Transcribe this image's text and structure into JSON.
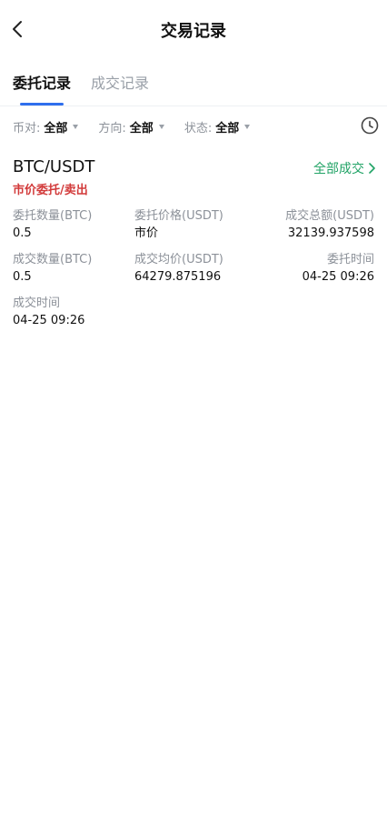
{
  "header": {
    "title": "交易记录"
  },
  "tabs": [
    {
      "label": "委托记录",
      "active": true
    },
    {
      "label": "成交记录",
      "active": false
    }
  ],
  "filters": [
    {
      "label": "币对:",
      "value": "全部"
    },
    {
      "label": "方向:",
      "value": "全部"
    },
    {
      "label": "状态:",
      "value": "全部"
    }
  ],
  "order": {
    "pair": "BTC/USDT",
    "type": "市价委托/卖出",
    "status": "全部成交",
    "fields": [
      {
        "label": "委托数量(BTC)",
        "value": "0.5"
      },
      {
        "label": "委托价格(USDT)",
        "value": "市价"
      },
      {
        "label": "成交总额(USDT)",
        "value": "32139.937598"
      },
      {
        "label": "成交数量(BTC)",
        "value": "0.5"
      },
      {
        "label": "成交均价(USDT)",
        "value": "64279.875196"
      },
      {
        "label": "委托时间",
        "value": "04-25 09:26"
      },
      {
        "label": "成交时间",
        "value": "04-25 09:26"
      }
    ]
  },
  "colors": {
    "accent": "#2f6fed",
    "sell": "#d23a3a",
    "filled": "#21a366"
  },
  "icons": {
    "back": "chevron-left-icon",
    "history": "clock-icon",
    "status_arrow": "chevron-right-icon"
  }
}
